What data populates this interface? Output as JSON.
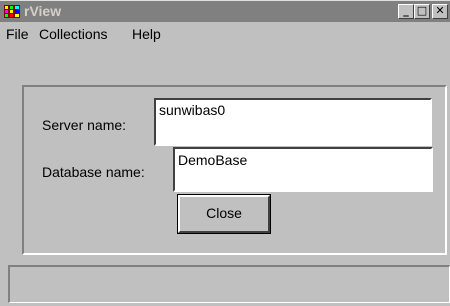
{
  "window": {
    "title": "rView",
    "min_glyph": "_",
    "max_glyph": "□",
    "close_glyph": "✕",
    "titlebar_color": "#808080",
    "title_text_color": "#d4d0c8"
  },
  "menu": {
    "items": [
      {
        "label": "File"
      },
      {
        "label": "Collections"
      },
      {
        "label": "Help"
      }
    ]
  },
  "form": {
    "server_label": "Server name:",
    "server_value": "sunwibas0",
    "database_label": "Database name:",
    "database_value": "DemoBase",
    "close_label": "Close"
  },
  "status": {
    "text": ""
  }
}
